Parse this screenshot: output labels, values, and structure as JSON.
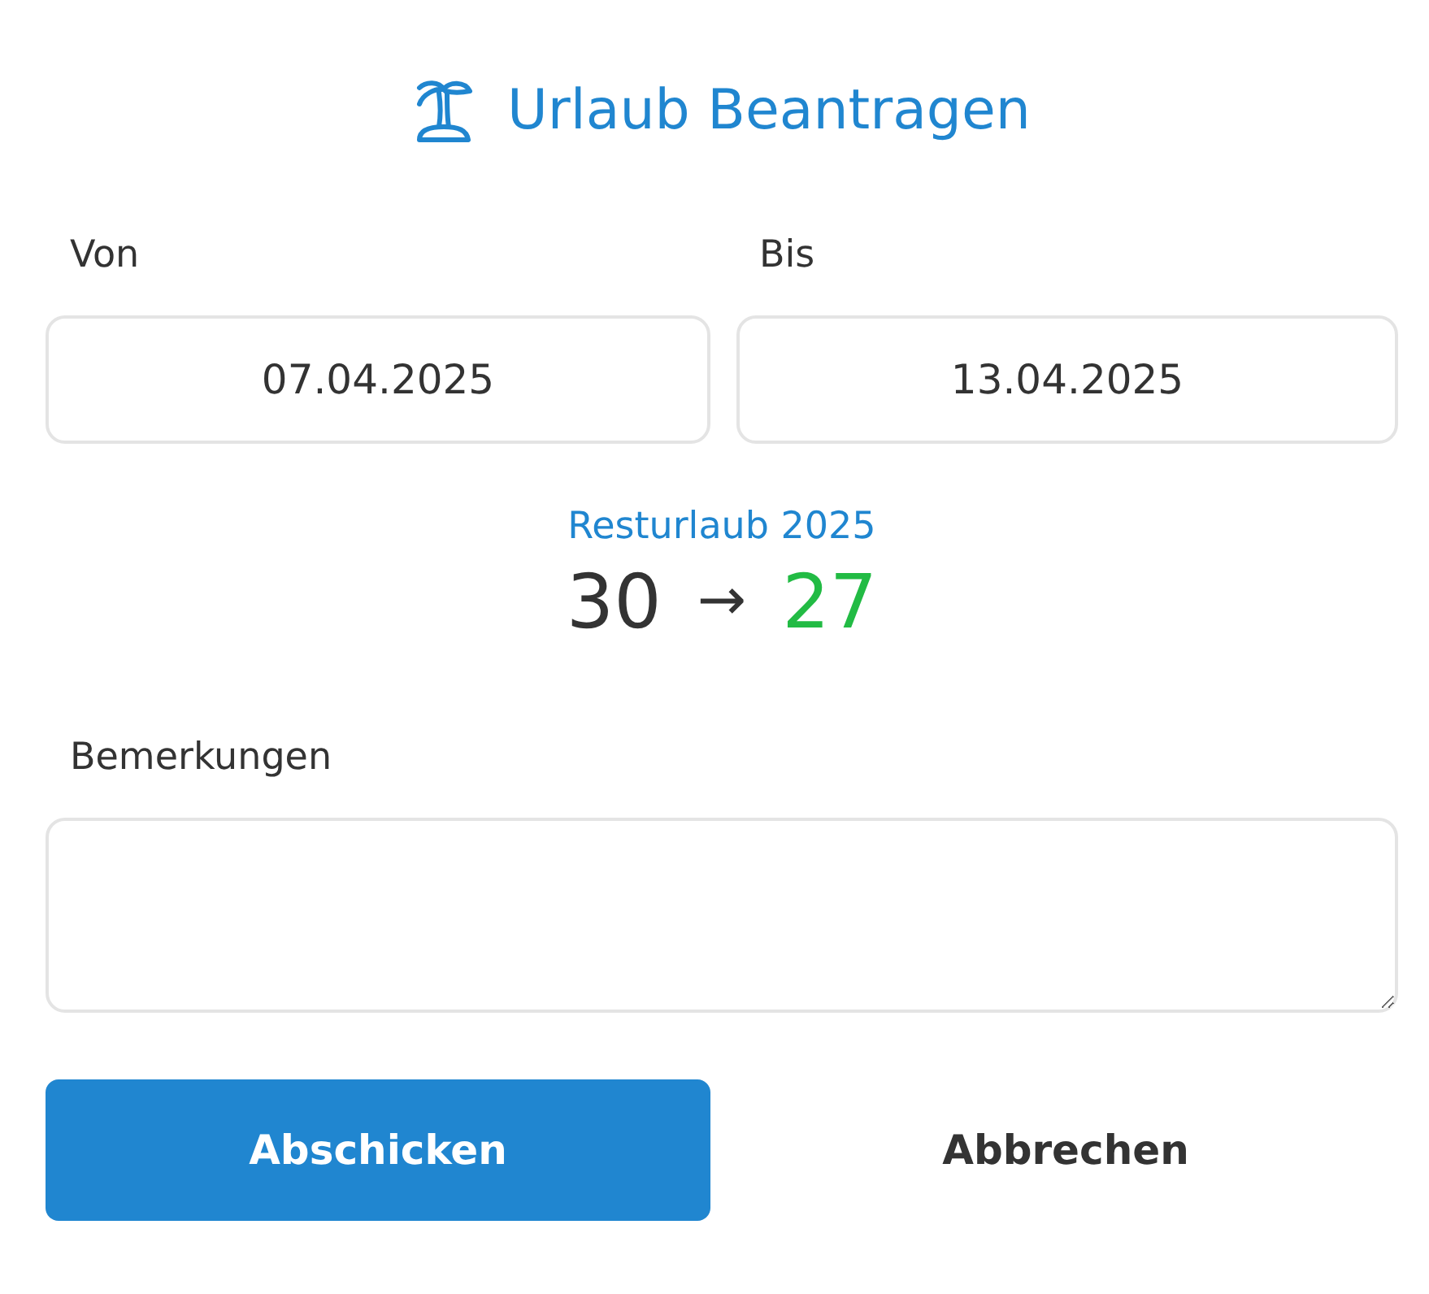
{
  "title": "Urlaub Beantragen",
  "from": {
    "label": "Von",
    "value": "07.04.2025"
  },
  "to": {
    "label": "Bis",
    "value": "13.04.2025"
  },
  "balance": {
    "label": "Resturlaub 2025",
    "before": "30",
    "arrow": "→",
    "after": "27"
  },
  "remarks": {
    "label": "Bemerkungen"
  },
  "buttons": [
    {
      "label": "Abschicken",
      "kind": "primary"
    },
    {
      "label": "Abbrechen",
      "kind": "secondary"
    }
  ]
}
